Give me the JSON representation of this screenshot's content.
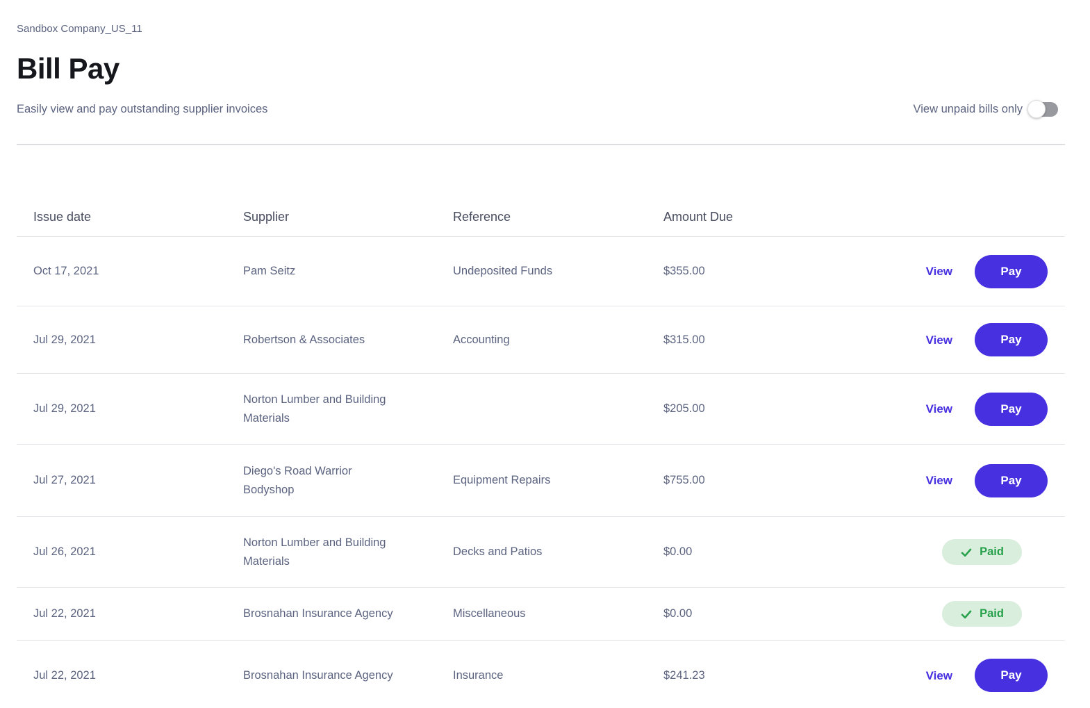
{
  "header": {
    "company": "Sandbox Company_US_11",
    "title": "Bill Pay",
    "subtitle": "Easily view and pay outstanding supplier invoices",
    "toggle": {
      "label": "View unpaid bills only",
      "state": "off"
    }
  },
  "table": {
    "columns": [
      "Issue date",
      "Supplier",
      "Reference",
      "Amount Due"
    ],
    "actions": {
      "view_label": "View",
      "pay_label": "Pay",
      "paid_label": "Paid"
    },
    "rows": [
      {
        "issue_date": "Oct 17, 2021",
        "supplier": "Pam Seitz",
        "reference": "Undeposited Funds",
        "amount_due": "$355.00",
        "status": "unpaid"
      },
      {
        "issue_date": "Jul 29, 2021",
        "supplier": "Robertson & Associates",
        "reference": "Accounting",
        "amount_due": "$315.00",
        "status": "unpaid"
      },
      {
        "issue_date": "Jul 29, 2021",
        "supplier": "Norton Lumber and Building Materials",
        "reference": "",
        "amount_due": "$205.00",
        "status": "unpaid"
      },
      {
        "issue_date": "Jul 27, 2021",
        "supplier": "Diego's Road Warrior Bodyshop",
        "reference": "Equipment Repairs",
        "amount_due": "$755.00",
        "status": "unpaid"
      },
      {
        "issue_date": "Jul 26, 2021",
        "supplier": "Norton Lumber and Building Materials",
        "reference": "Decks and Patios",
        "amount_due": "$0.00",
        "status": "paid"
      },
      {
        "issue_date": "Jul 22, 2021",
        "supplier": "Brosnahan Insurance Agency",
        "reference": "Miscellaneous",
        "amount_due": "$0.00",
        "status": "paid"
      },
      {
        "issue_date": "Jul 22, 2021",
        "supplier": "Brosnahan Insurance Agency",
        "reference": "Insurance",
        "amount_due": "$241.23",
        "status": "unpaid"
      }
    ]
  },
  "colors": {
    "accent": "#4630e0",
    "paid_green": "#27a04b",
    "paid_bg": "#d9eedd",
    "text_body": "#5b6380",
    "text_head": "#474c5e",
    "title_color": "#15171c",
    "divider": "#e3e5e9"
  }
}
